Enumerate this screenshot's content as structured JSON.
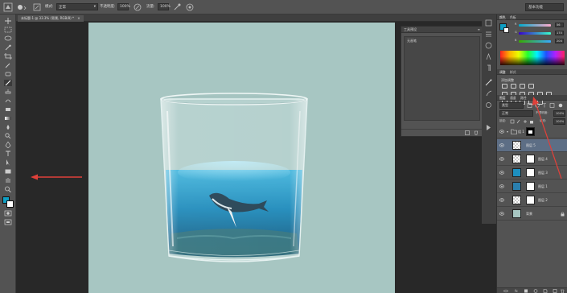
{
  "options_bar": {
    "mode_label": "模式:",
    "mode_value": "正常",
    "opacity_label": "不透明度:",
    "opacity_value": "100%",
    "flow_label": "流量:",
    "flow_value": "100%",
    "workspace": "基本功能"
  },
  "document_tab": "未标题-1 @ 33.3% (背景, RGB/8) *",
  "tool_presets_panel": {
    "title": "工具预设",
    "item": "无画笔"
  },
  "color_panel": {
    "tabs": [
      "颜色",
      "色板"
    ],
    "rows": [
      {
        "label": "R",
        "value": "56"
      },
      {
        "label": "G",
        "value": "170"
      },
      {
        "label": "B",
        "value": "204"
      }
    ],
    "fg_color": "#0f9fc4",
    "bg_color": "#ffffff"
  },
  "adjustments_panel": {
    "tabs": [
      "调整",
      "样式"
    ],
    "title": "添加调整"
  },
  "layers_panel": {
    "tabs": [
      "图层",
      "通道",
      "路径"
    ],
    "filter_label": "类型",
    "blend_mode": "正常",
    "opacity_label": "不透明度:",
    "opacity_value": "100%",
    "lock_label": "锁定:",
    "fill_label": "填充:",
    "fill_value": "100%",
    "layers": [
      {
        "name": "组 1",
        "type": "group"
      },
      {
        "name": "图层 5",
        "type": "normal"
      },
      {
        "name": "图层 4",
        "type": "masked"
      },
      {
        "name": "图层 3",
        "type": "masked"
      },
      {
        "name": "图层 1",
        "type": "masked"
      },
      {
        "name": "图层 2",
        "type": "masked"
      },
      {
        "name": "背景",
        "type": "background"
      }
    ]
  },
  "colors": {
    "accent_selection": "#5d6e85",
    "canvas_bg": "#a7c6c2",
    "annotation_arrow": "#e0413a"
  }
}
